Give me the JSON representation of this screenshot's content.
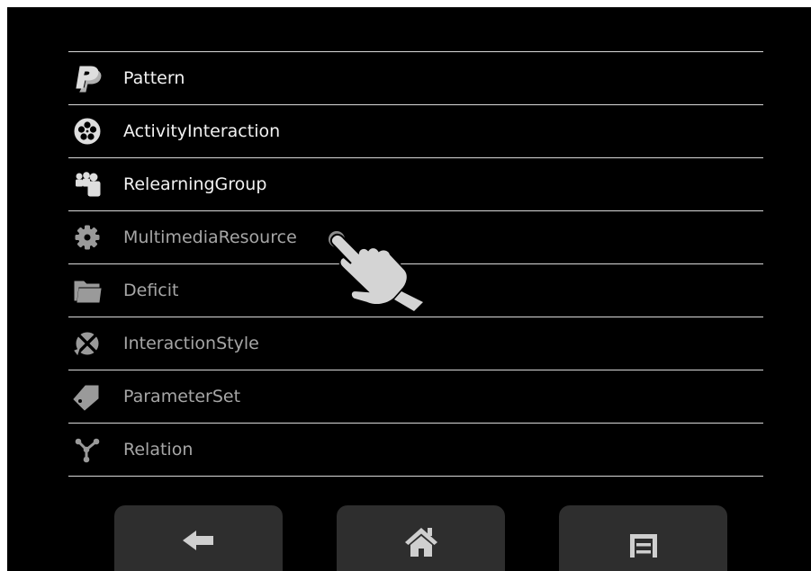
{
  "menu": {
    "items": [
      {
        "label": "Pattern",
        "icon": "paypal-p-icon",
        "state": "active"
      },
      {
        "label": "ActivityInteraction",
        "icon": "film-reel-icon",
        "state": "active"
      },
      {
        "label": "RelearningGroup",
        "icon": "people-group-icon",
        "state": "active"
      },
      {
        "label": "MultimediaResource",
        "icon": "gear-icon",
        "state": "disabled"
      },
      {
        "label": "Deficit",
        "icon": "folders-icon",
        "state": "disabled"
      },
      {
        "label": "InteractionStyle",
        "icon": "crossed-circle-icon",
        "state": "disabled"
      },
      {
        "label": "ParameterSet",
        "icon": "tag-icon",
        "state": "disabled"
      },
      {
        "label": "Relation",
        "icon": "node-graph-icon",
        "state": "disabled"
      }
    ]
  },
  "cursor": {
    "icon": "pointing-hand-cursor-icon"
  },
  "navbar": {
    "back": {
      "icon": "back-arrow-icon"
    },
    "home": {
      "icon": "home-icon"
    },
    "menu": {
      "icon": "menu-icon"
    }
  },
  "colors": {
    "background": "#000000",
    "active_text": "#f2f2f2",
    "disabled_text": "#a6a6a6",
    "divider": "#d9d9d9",
    "nav_button": "#2e2e2e"
  }
}
